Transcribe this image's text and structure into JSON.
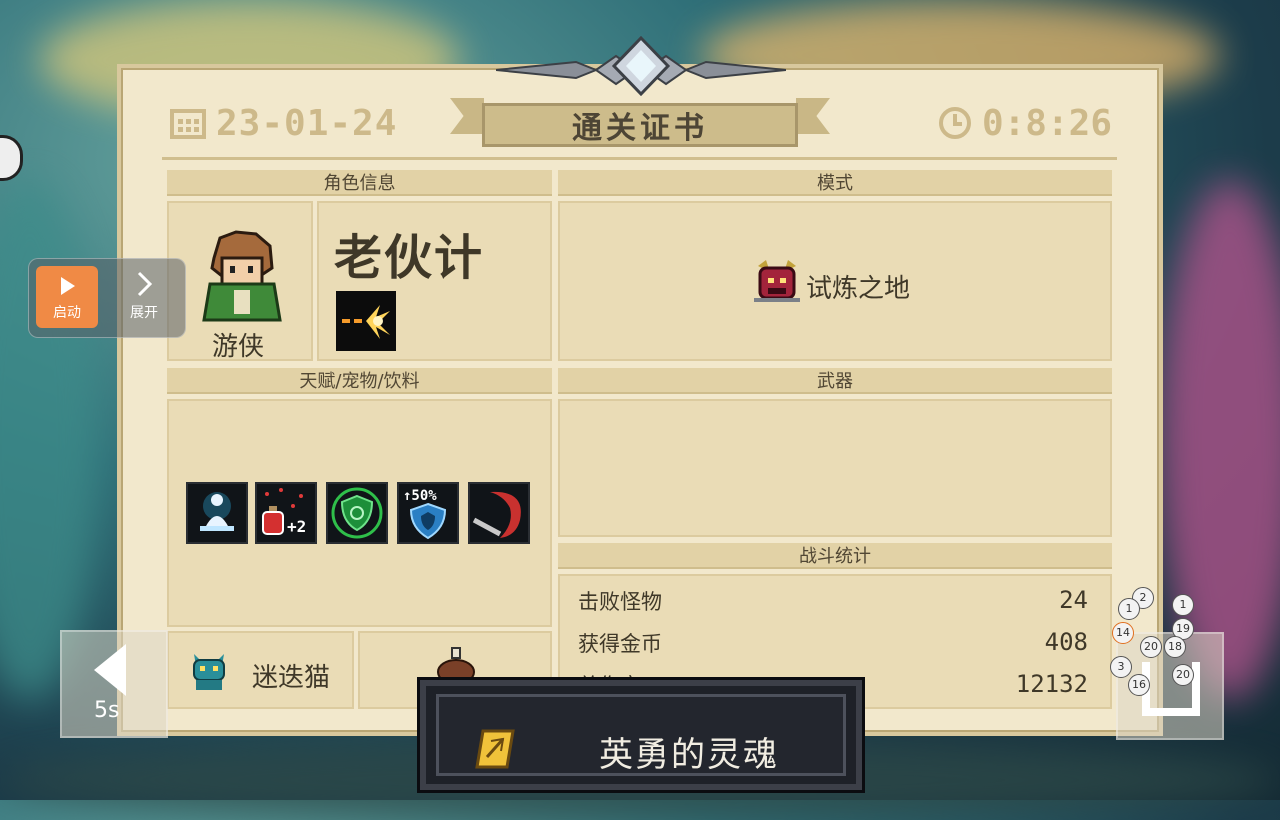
{
  "certificate": {
    "date": "23-01-24",
    "title": "通关证书",
    "time": "0:8:26"
  },
  "sections": {
    "character_info": "角色信息",
    "mode": "模式",
    "talents_pets_drinks": "天赋/宠物/饮料",
    "weapons": "武器",
    "battle_stats": "战斗统计"
  },
  "character": {
    "name": "老伙计",
    "class": "游侠"
  },
  "mode": {
    "name": "试炼之地"
  },
  "talents": [
    {
      "icon": "meditation-talent-icon"
    },
    {
      "icon": "potion-plus2-talent-icon",
      "badge": "+2"
    },
    {
      "icon": "green-shield-talent-icon"
    },
    {
      "icon": "shield-50-percent-talent-icon",
      "badge": "+50%"
    },
    {
      "icon": "red-scythe-talent-icon"
    }
  ],
  "pet": {
    "name": "迷迭猫"
  },
  "stats": [
    {
      "label": "击败怪物",
      "value": "24"
    },
    {
      "label": "获得金币",
      "value": "408"
    },
    {
      "label": "总伤害",
      "value": "12132"
    }
  ],
  "toast": {
    "text": "英勇的灵魂"
  },
  "overlay": {
    "start_label": "启动",
    "expand_label": "展开",
    "skip_label": "5s"
  },
  "bubbles": [
    "2",
    "1",
    "1",
    "14",
    "19",
    "20",
    "18",
    "3",
    "20",
    "16"
  ]
}
